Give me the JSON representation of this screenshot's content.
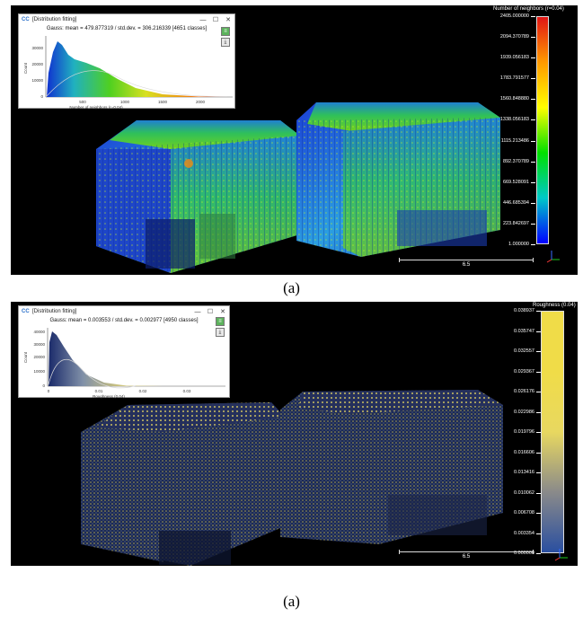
{
  "panel_a": {
    "window": {
      "title": "[Distribution fitting]",
      "controls": [
        "—",
        "☐",
        "✕"
      ],
      "stats": "Gauss: mean = 479.877319 / std.dev. = 306.216339 [4651 classes]",
      "y_label": "Count",
      "x_label": "Number of neighbors (r=0.04)",
      "y_ticks": [
        "30000",
        "20000",
        "10000",
        "0"
      ],
      "x_ticks": [
        "500",
        "1000",
        "1500",
        "2000"
      ]
    },
    "scale": {
      "title": "Number of neighbors (r=0.04)",
      "ticks": [
        "2405.000000",
        "2094.370789",
        "1939.056183",
        "1783.791577",
        "1560.848880",
        "1338.056183",
        "1115.213486",
        "892.370789",
        "669.528091",
        "446.685394",
        "223.842697",
        "1.000000"
      ],
      "colors": [
        "#e01515",
        "#ff9a00",
        "#ffff00",
        "#00e000",
        "#00c8c8",
        "#0000ff"
      ]
    },
    "scale_bar_label": "6.5",
    "caption": "(a)"
  },
  "panel_b": {
    "window": {
      "title": "[Distribution fitting]",
      "controls": [
        "—",
        "☐",
        "✕"
      ],
      "stats": "Gauss: mean = 0.003553 / std.dev. = 0.002977 [4950 classes]",
      "y_label": "Count",
      "x_label": "Roughness (0.04)",
      "y_ticks": [
        "40000",
        "30000",
        "20000",
        "10000",
        "0"
      ],
      "x_ticks": [
        "0",
        "0.01",
        "0.02",
        "0.03"
      ]
    },
    "scale": {
      "title": "Roughness (0.04)",
      "ticks": [
        "0.038937",
        "0.035747",
        "0.032557",
        "0.029367",
        "0.026176",
        "0.022986",
        "0.019796",
        "0.016606",
        "0.013416",
        "0.010062",
        "0.006708",
        "0.003354",
        "0.000000"
      ],
      "colors": [
        "#f0dc48",
        "#f0dc48",
        "#e8d860",
        "#8a8a8a",
        "#2a4fa0"
      ]
    },
    "scale_bar_label": "6.5",
    "caption": "(a)"
  }
}
